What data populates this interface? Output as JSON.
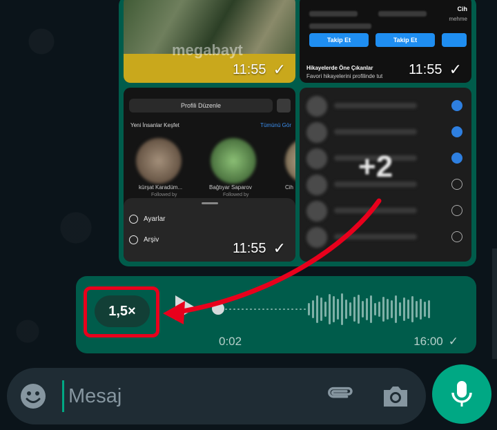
{
  "album": {
    "tiles": [
      {
        "time": "11:55",
        "watermark": "megabayt"
      },
      {
        "time": "11:55",
        "follow_label": "Takip Et",
        "highlights_title": "Hikayelerde Öne Çıkanlar",
        "highlights_sub": "Favori hikayelerini profilinde tut",
        "side_name": "Cih",
        "side_sub": "mehme"
      },
      {
        "time": "11:55",
        "edit_profile": "Profili Düzenle",
        "discover": "Yeni İnsanlar Keşfet",
        "see_all": "Tümünü Gör",
        "suggestions": [
          "kürşat Karadüm...",
          "Bağtıyar Saparov",
          "Cih"
        ],
        "followed_by": "Followed by",
        "menu": [
          "Ayarlar",
          "Arşiv"
        ]
      },
      {
        "more_count": "+2",
        "checks": [
          true,
          true,
          true,
          false,
          false,
          false
        ]
      }
    ]
  },
  "voice": {
    "speed": "1,5×",
    "elapsed": "0:02",
    "sent_time": "16:00",
    "status_tick": "✓"
  },
  "composer": {
    "placeholder": "Mesaj"
  },
  "icons": {
    "emoji": "emoji-icon",
    "attach": "paperclip-icon",
    "camera": "camera-icon",
    "mic": "mic-icon",
    "play": "play-icon"
  },
  "colors": {
    "bubble": "#005c4b",
    "accent": "#00a884",
    "highlight": "#e8001c"
  }
}
